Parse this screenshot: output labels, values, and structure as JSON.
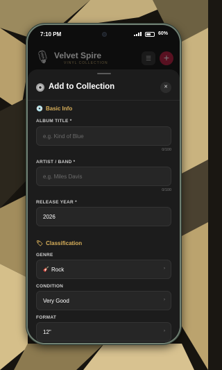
{
  "status": {
    "time": "7:10 PM",
    "battery": "60%"
  },
  "app": {
    "title": "Velvet Spire",
    "subtitle": "VINYL COLLECTION"
  },
  "sheet": {
    "title": "Add to Collection",
    "close": "✕"
  },
  "basic": {
    "section": "Basic Info",
    "album": {
      "label": "ALBUM TITLE *",
      "placeholder": "e.g. Kind of Blue",
      "counter": "0/100"
    },
    "artist": {
      "label": "ARTIST / BAND *",
      "placeholder": "e.g. Miles Davis",
      "counter": "0/100"
    },
    "year": {
      "label": "RELEASE YEAR *",
      "value": "2026"
    }
  },
  "classification": {
    "section": "Classification",
    "genre": {
      "label": "GENRE",
      "value": "Rock"
    },
    "condition": {
      "label": "CONDITION",
      "value": "Very Good"
    },
    "format": {
      "label": "FORMAT",
      "value": "12\""
    }
  },
  "colors": {
    "accent": "#d9b05a",
    "add_button": "#b3163a",
    "sheet": "#1c1c1c"
  }
}
